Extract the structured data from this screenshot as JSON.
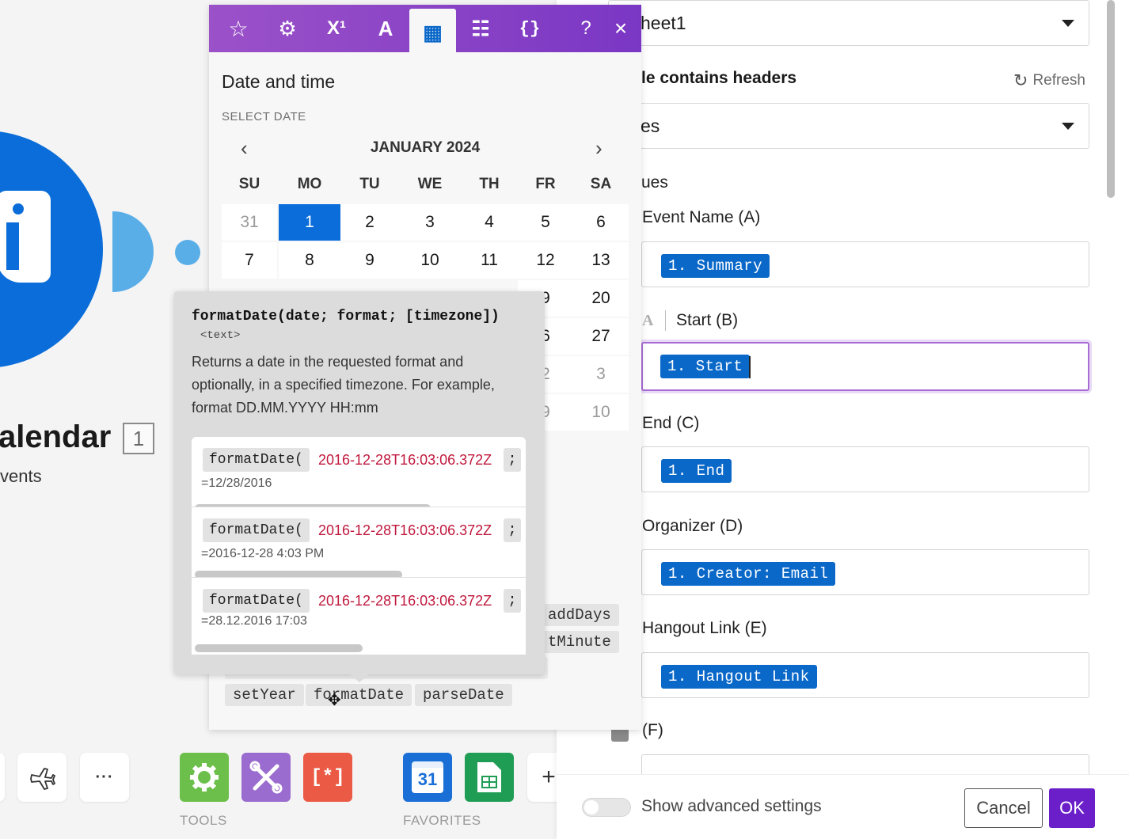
{
  "canvas": {
    "module_title": "alendar",
    "module_badge": "1",
    "module_subtitle": "vents",
    "toolbar": {
      "more_label": "···",
      "tools_label": "TOOLS",
      "favorites_label": "FAVORITES",
      "calendar_tile_text": "31",
      "add_label": "+"
    }
  },
  "panel": {
    "sheet_value": "heet1",
    "headers_label": "le contains headers",
    "refresh_label": "Refresh",
    "headers_value": "es",
    "values_label": "ues",
    "fields": [
      {
        "label": "Event Name (A)",
        "pill": "1. Summary"
      },
      {
        "label": "Start (B)",
        "pill": "1. Start",
        "prefix": "A"
      },
      {
        "label": "End (C)",
        "pill": "1. End"
      },
      {
        "label": "Organizer (D)",
        "pill": "1. Creator: Email"
      },
      {
        "label": "Hangout Link (E)",
        "pill": "1. Hangout Link"
      },
      {
        "label": "(F)",
        "pill": ""
      }
    ],
    "advanced_label": "Show advanced settings",
    "cancel_label": "Cancel",
    "ok_label": "OK"
  },
  "picker": {
    "tabs": [
      "star-icon",
      "gear-icon",
      "superscript-icon",
      "text-icon",
      "calendar-icon",
      "table-icon",
      "braces-icon"
    ],
    "tab_glyphs": [
      "☆",
      "⚙",
      "X¹",
      "A",
      "▦",
      "☷",
      "{}"
    ],
    "help_label": "?",
    "close_label": "×",
    "title": "Date and time",
    "select_date_label": "SELECT DATE",
    "month_label": "JANUARY 2024",
    "weekdays": [
      "SU",
      "MO",
      "TU",
      "WE",
      "TH",
      "FR",
      "SA"
    ],
    "weeks": [
      [
        "31",
        "1",
        "2",
        "3",
        "4",
        "5",
        "6"
      ],
      [
        "7",
        "8",
        "9",
        "10",
        "11",
        "12",
        "13"
      ],
      [
        "",
        "",
        "",
        "",
        "",
        "9",
        "20"
      ],
      [
        "",
        "",
        "",
        "",
        "",
        "6",
        "27"
      ],
      [
        "",
        "",
        "",
        "",
        "",
        "2",
        "3"
      ],
      [
        "",
        "",
        "",
        "",
        "",
        "9",
        "10"
      ]
    ],
    "selected_day": "1",
    "functions_right": [
      "addDays",
      "tMinute"
    ],
    "functions_bottom": [
      "setYear",
      "formatDate",
      "parseDate"
    ]
  },
  "tooltip": {
    "signature": "formatDate(date; format; [timezone])",
    "returns": "<text>",
    "description": "Returns a date in the requested format and optionally, in a specified timezone. For example, format DD.MM.YYYY HH:mm",
    "examples": [
      {
        "fn": "formatDate(",
        "arg": "2016-12-28T16:03:06.372Z",
        "semi": ";",
        "result": "=12/28/2016"
      },
      {
        "fn": "formatDate(",
        "arg": "2016-12-28T16:03:06.372Z",
        "semi": ";",
        "result": "=2016-12-28 4:03 PM"
      },
      {
        "fn": "formatDate(",
        "arg": "2016-12-28T16:03:06.372Z",
        "semi": ";",
        "result": "=28.12.2016 17:03"
      }
    ]
  },
  "colors": {
    "accent_blue": "#0a6dd9",
    "header_purple": "#8a44c6",
    "ok_purple": "#6a1fc9",
    "example_red": "#c0183c",
    "tools_green": "#6cbf4a",
    "tools_purple": "#9b6ccf",
    "tools_red": "#ea5a45",
    "sheets_green": "#1f9d55"
  }
}
